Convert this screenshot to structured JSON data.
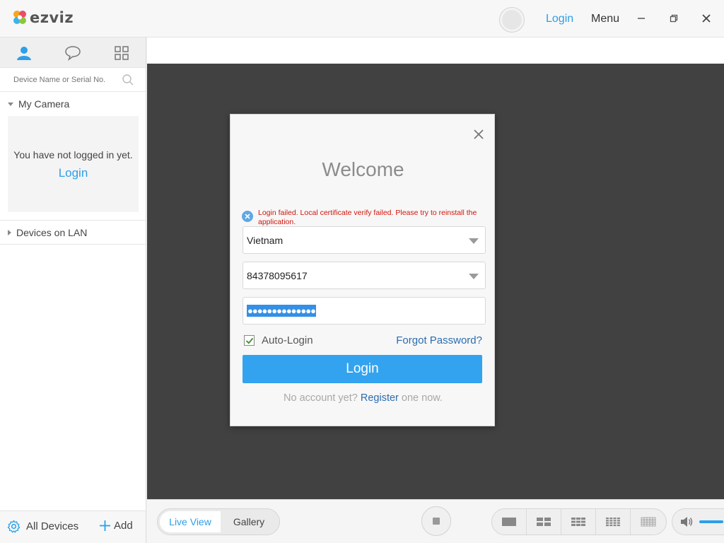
{
  "app": {
    "logo_text": "ezviz"
  },
  "titlebar": {
    "login_label": "Login",
    "menu_label": "Menu"
  },
  "sidebar": {
    "search_placeholder": "Device Name or Serial No.",
    "my_camera_label": "My Camera",
    "not_logged_text": "You have not logged in yet.",
    "not_logged_login": "Login",
    "lan_label": "Devices on LAN",
    "all_devices_label": "All Devices",
    "add_label": "Add"
  },
  "bottombar": {
    "live_view_label": "Live View",
    "gallery_label": "Gallery"
  },
  "dialog": {
    "title": "Welcome",
    "error_text": "Login failed. Local certificate verify failed. Please try to reinstall the application.",
    "country_value": "Vietnam",
    "phone_value": "84378095617",
    "password_mask": "●●●●●●●●●●●●●●",
    "auto_login_label": "Auto-Login",
    "auto_login_checked": true,
    "forgot_label": "Forgot Password?",
    "login_button": "Login",
    "register_prefix": "No account yet? ",
    "register_link": "Register",
    "register_suffix": " one now."
  },
  "colors": {
    "accent": "#2d9fe8",
    "error": "#d2140a",
    "viewport": "#414141",
    "link_dark": "#2b6cb0"
  }
}
